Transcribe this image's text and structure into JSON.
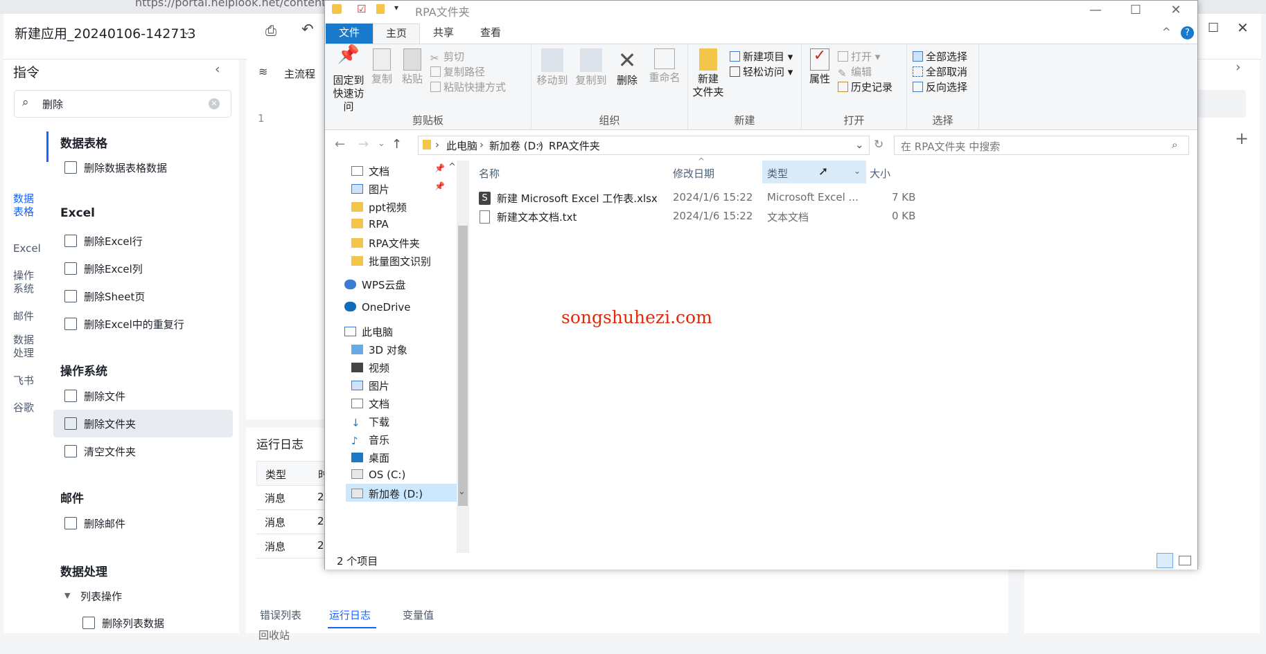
{
  "browser": {
    "url": "https://portal.helplook.net/content"
  },
  "app": {
    "title": "新建应用_20240106-142713",
    "sidebar": {
      "title": "指令",
      "search_value": "删除",
      "categories": [
        "数据表格",
        "Excel",
        "操作系统",
        "邮件",
        "数据处理",
        "飞书",
        "谷歌"
      ],
      "sections": [
        {
          "title": "数据表格",
          "items": [
            "删除数据表格数据"
          ]
        },
        {
          "title": "Excel",
          "items": [
            "删除Excel行",
            "删除Excel列",
            "删除Sheet页",
            "删除Excel中的重复行"
          ]
        },
        {
          "title": "操作系统",
          "items": [
            "删除文件",
            "删除文件夹",
            "清空文件夹"
          ]
        },
        {
          "title": "邮件",
          "items": [
            "删除邮件"
          ]
        },
        {
          "title": "数据处理",
          "subgroup": "列表操作",
          "items": [
            "删除列表数据"
          ]
        }
      ]
    },
    "main": {
      "tab": "主流程",
      "line_number": "1",
      "log_title": "运行日志",
      "log_headers": [
        "类型",
        "时"
      ],
      "log_rows": [
        [
          "消息",
          "2"
        ],
        [
          "消息",
          "2"
        ],
        [
          "消息",
          "2"
        ]
      ],
      "bottom_tabs": [
        "错误列表",
        "运行日志",
        "变量值"
      ],
      "bottom_partial": "回收站"
    }
  },
  "explorer": {
    "title": "RPA文件夹",
    "tabs": [
      "文件",
      "主页",
      "共享",
      "查看"
    ],
    "ribbon": {
      "clipboard": {
        "label": "剪贴板",
        "pin": "固定到\n快速访问",
        "copy": "复制",
        "paste": "粘贴",
        "cut": "剪切",
        "copy_path": "复制路径",
        "paste_shortcut": "粘贴快捷方式"
      },
      "organize": {
        "label": "组织",
        "move_to": "移动到",
        "copy_to": "复制到",
        "delete": "删除",
        "rename": "重命名"
      },
      "new": {
        "label": "新建",
        "new_folder": "新建\n文件夹",
        "new_item": "新建项目",
        "easy_access": "轻松访问"
      },
      "open": {
        "label": "打开",
        "properties": "属性",
        "open": "打开",
        "edit": "编辑",
        "history": "历史记录"
      },
      "select": {
        "label": "选择",
        "select_all": "全部选择",
        "select_none": "全部取消",
        "invert": "反向选择"
      }
    },
    "address": [
      "此电脑",
      "新加卷 (D:)",
      "RPA文件夹"
    ],
    "search_placeholder": "在 RPA文件夹 中搜索",
    "nav_items": [
      "文档",
      "图片",
      "ppt视频",
      "RPA",
      "RPA文件夹",
      "批量图文识别",
      "WPS云盘",
      "OneDrive",
      "此电脑",
      "3D 对象",
      "视频",
      "图片",
      "文档",
      "下载",
      "音乐",
      "桌面",
      "OS (C:)",
      "新加卷 (D:)"
    ],
    "columns": [
      "名称",
      "修改日期",
      "类型",
      "大小"
    ],
    "files": [
      {
        "name": "新建 Microsoft Excel 工作表.xlsx",
        "date": "2024/1/6 15:22",
        "type": "Microsoft Excel ...",
        "size": "7 KB"
      },
      {
        "name": "新建文本文档.txt",
        "date": "2024/1/6 15:22",
        "type": "文本文档",
        "size": "0 KB"
      }
    ],
    "status": "2 个项目"
  },
  "watermark": "songshuhezi.com",
  "colors": {
    "accent": "#1664ff",
    "file_tab": "#1979ca",
    "watermark": "#e02a0a"
  }
}
